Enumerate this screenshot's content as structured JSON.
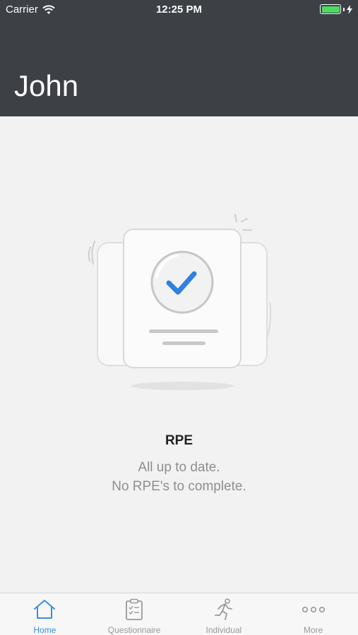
{
  "status_bar": {
    "carrier": "Carrier",
    "time": "12:25 PM",
    "battery_level": 1.0
  },
  "header": {
    "title": "John",
    "background": "#3d4045"
  },
  "empty_state": {
    "title": "RPE",
    "line1": "All up to date.",
    "line2": "No RPE's to complete.",
    "icon": "checklist-done-illustration",
    "check_color": "#2f80e0"
  },
  "tabbar": {
    "accent": "#3b8fd9",
    "tabs": [
      {
        "label": "Home",
        "icon": "home-icon",
        "active": true
      },
      {
        "label": "Questionnaire",
        "icon": "clipboard-icon",
        "active": false
      },
      {
        "label": "Individual",
        "icon": "runner-icon",
        "active": false
      },
      {
        "label": "More",
        "icon": "more-dots-icon",
        "active": false
      }
    ]
  }
}
